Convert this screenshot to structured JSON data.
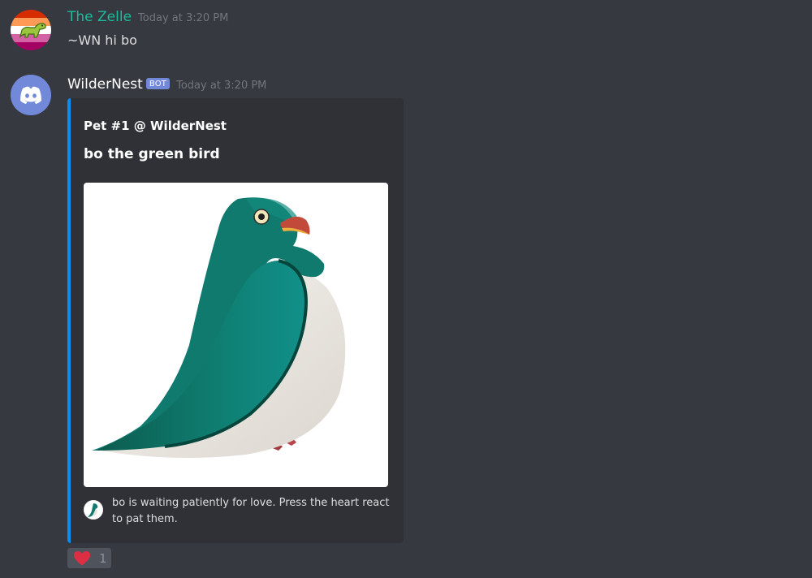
{
  "messages": [
    {
      "username": "The Zelle",
      "timestamp": "Today at 3:20 PM",
      "text": "~WN hi bo",
      "avatar_icon": "lesbian-flag-dino-avatar",
      "username_color": "#1abc9c"
    },
    {
      "username": "WilderNest",
      "bot_tag": "BOT",
      "timestamp": "Today at 3:20 PM",
      "avatar_icon": "discord-logo-avatar",
      "username_color": "#ffffff",
      "embed": {
        "author": "Pet #1 @ WilderNest",
        "title": "bo the green bird",
        "image_icon": "green-bird-illustration",
        "footer_icon": "bird-thumbnail-icon",
        "footer_text": "bo is waiting patiently for love. Press the heart react to pat them.",
        "accent_color": "#0c8df0"
      },
      "reactions": [
        {
          "emoji": "heart-icon",
          "count": "1"
        }
      ]
    }
  ],
  "colors": {
    "background": "#36393f",
    "embed_background": "#2f3136",
    "bot_tag": "#7289da",
    "discord_blurple": "#7289da",
    "reaction_background": "#4f545c",
    "heart": "#dd2e44"
  }
}
